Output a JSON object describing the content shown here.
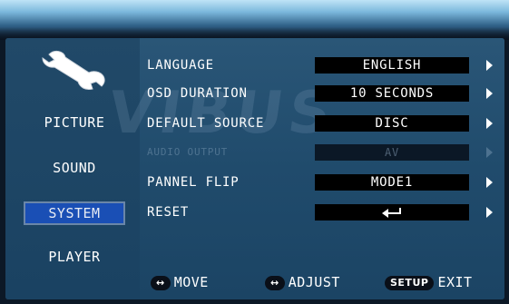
{
  "menu": {
    "categories": [
      {
        "label": "PICTURE",
        "active": false
      },
      {
        "label": "SOUND",
        "active": false
      },
      {
        "label": "SYSTEM",
        "active": true
      },
      {
        "label": "PLAYER",
        "active": false
      }
    ],
    "settings": [
      {
        "label": "LANGUAGE",
        "value": "ENGLISH"
      },
      {
        "label": "OSD DURATION",
        "value": "10 SECONDS"
      },
      {
        "label": "DEFAULT SOURCE",
        "value": "DISC"
      },
      {
        "label": "AUDIO OUTPUT",
        "value": "AV",
        "disabled": true
      },
      {
        "label": "PANNEL FLIP",
        "value": "MODE1"
      },
      {
        "label": "RESET",
        "value_icon": "return-arrow-icon"
      }
    ]
  },
  "footer": {
    "move": {
      "key": "↔",
      "label": "MOVE"
    },
    "adjust": {
      "key": "↔",
      "label": "ADJUST"
    },
    "exit": {
      "key": "SETUP",
      "label": "EXIT"
    }
  },
  "icons": {
    "category_icon": "wrench-icon",
    "row_arrow": "triangle-right-icon"
  },
  "colors": {
    "panel": "#1d4466",
    "value_box": "#000000",
    "active_category": "#1a4fb5"
  }
}
